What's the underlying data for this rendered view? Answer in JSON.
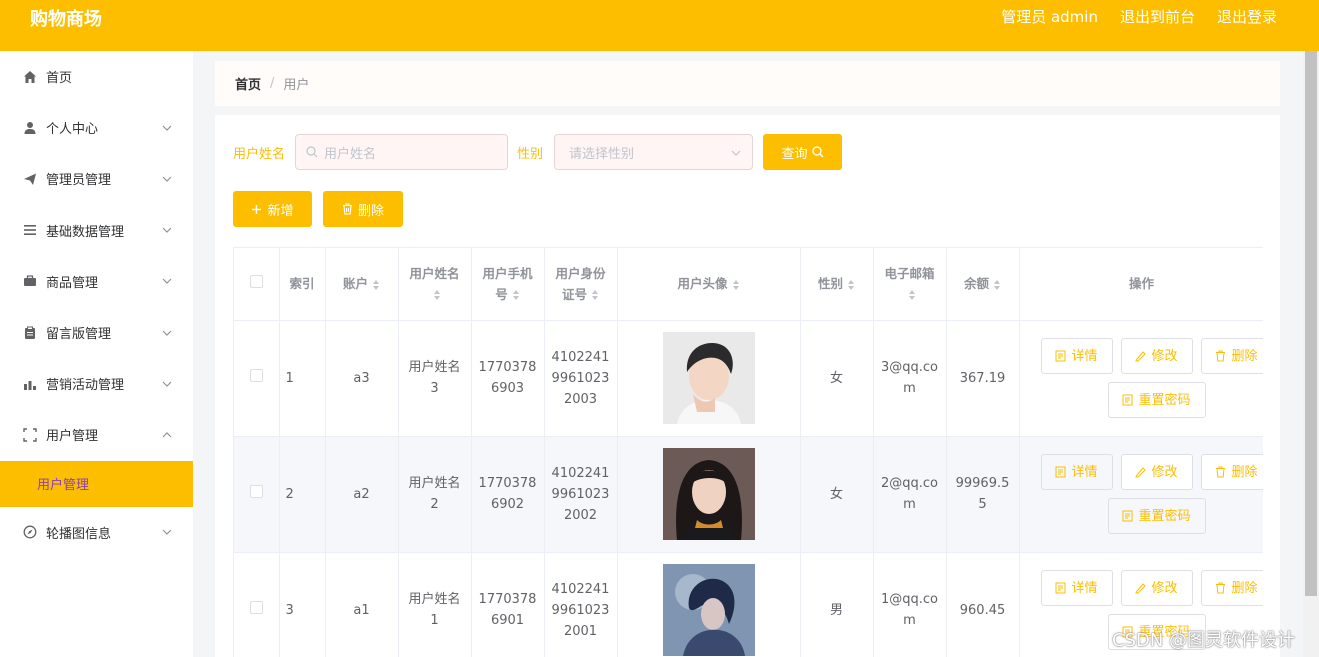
{
  "header": {
    "brand": "购物商场",
    "admin_label": "管理员 admin",
    "to_front": "退出到前台",
    "logout": "退出登录"
  },
  "sidebar": {
    "items": [
      {
        "label": "首页",
        "icon": "home-icon"
      },
      {
        "label": "个人中心",
        "icon": "user-icon"
      },
      {
        "label": "管理员管理",
        "icon": "send-icon"
      },
      {
        "label": "基础数据管理",
        "icon": "list-icon"
      },
      {
        "label": "商品管理",
        "icon": "box-icon"
      },
      {
        "label": "留言版管理",
        "icon": "clipboard-icon"
      },
      {
        "label": "营销活动管理",
        "icon": "chart-icon"
      },
      {
        "label": "用户管理",
        "icon": "frame-icon"
      },
      {
        "label": "轮播图信息",
        "icon": "compass-icon"
      }
    ],
    "active_submenu": "用户管理",
    "accent": "#fdbe00"
  },
  "breadcrumb": {
    "home": "首页",
    "separator": "/",
    "current": "用户"
  },
  "search": {
    "name_label": "用户姓名",
    "name_placeholder": "用户姓名",
    "gender_label": "性别",
    "gender_placeholder": "请选择性别",
    "query_button": "查询"
  },
  "actions": {
    "add": "新增",
    "delete": "删除"
  },
  "table": {
    "headers": {
      "index": "索引",
      "account": "账户",
      "name": "用户姓名",
      "phone": "用户手机号",
      "id_card": "用户身份证号",
      "avatar": "用户头像",
      "gender": "性别",
      "email": "电子邮箱",
      "balance": "余额",
      "operation": "操作"
    },
    "row_buttons": {
      "detail": "详情",
      "edit": "修改",
      "delete": "删除",
      "reset_password": "重置密码"
    },
    "rows": [
      {
        "index": "1",
        "account": "a3",
        "name": "用户姓名3",
        "phone": "17703786903",
        "id_card": "410224199610232003",
        "gender": "女",
        "email": "3@qq.com",
        "balance": "367.19"
      },
      {
        "index": "2",
        "account": "a2",
        "name": "用户姓名2",
        "phone": "17703786902",
        "id_card": "410224199610232002",
        "gender": "女",
        "email": "2@qq.com",
        "balance": "99969.55"
      },
      {
        "index": "3",
        "account": "a1",
        "name": "用户姓名1",
        "phone": "17703786901",
        "id_card": "410224199610232001",
        "gender": "男",
        "email": "1@qq.com",
        "balance": "960.45"
      }
    ]
  },
  "watermark": "CSDN @图灵软件设计"
}
